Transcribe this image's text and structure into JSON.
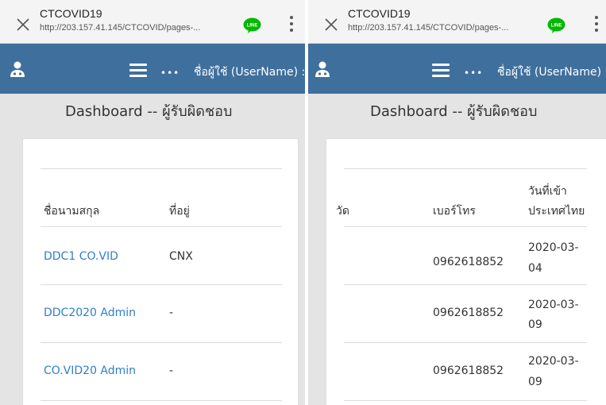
{
  "left_pane": {
    "browser": {
      "site_title": "CTCOVID19",
      "url": "http://203.157.41.145/CTCOVID/pages-..."
    },
    "navbar": {
      "menu_dots": "•••",
      "username_label": "ชื่อผู้ใช้ (UserName) :"
    },
    "dashboard_title": "Dashboard -- ผู้รับผิดชอบ",
    "table": {
      "columns": [
        "ชื่อนามสกุล",
        "ที่อยู่"
      ],
      "rows": [
        {
          "name": "DDC1 CO.VID",
          "address": "CNX"
        },
        {
          "name": "DDC2020 Admin",
          "address": "-"
        },
        {
          "name": "CO.VID20 Admin",
          "address": "-"
        }
      ]
    }
  },
  "right_pane": {
    "browser": {
      "site_title": "CTCOVID19",
      "url": "http://203.157.41.145/CTCOVID/pages-..."
    },
    "navbar": {
      "menu_dots": "•••",
      "username_label": "ชื่อผู้ใช้ (UserName) :"
    },
    "dashboard_title": "Dashboard -- ผู้รับผิดชอบ",
    "table": {
      "columns": [
        "วัด",
        "เบอร์โทร",
        "วันที่เข้า",
        "ประเทศไทย"
      ],
      "rows": [
        {
          "phone": "0962618852",
          "date_line1": "2020-03-",
          "date_line2": "04"
        },
        {
          "phone": "0962618852",
          "date_line1": "2020-03-",
          "date_line2": "09"
        },
        {
          "phone": "0962618852",
          "date_line1": "2020-03-",
          "date_line2": "09"
        }
      ]
    }
  },
  "colors": {
    "navbar": "#3f6f9c",
    "link": "#2f80c8",
    "line_icon": "#00b900"
  },
  "icons": [
    "close-icon",
    "line-app-icon",
    "kebab-menu-icon",
    "user-group-icon",
    "hamburger-menu-icon"
  ]
}
